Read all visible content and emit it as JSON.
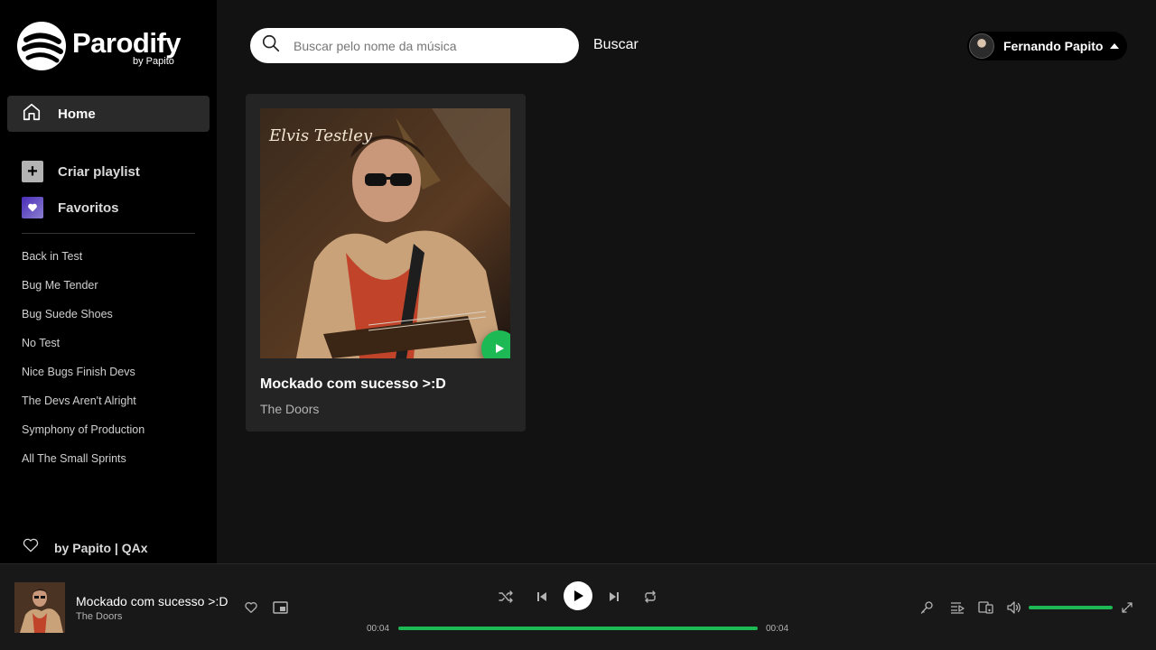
{
  "app": {
    "name": "Parodify",
    "byline": "by Papito"
  },
  "search": {
    "placeholder": "Buscar pelo nome da música",
    "button_label": "Buscar"
  },
  "user": {
    "name": "Fernando Papito"
  },
  "sidebar": {
    "home_label": "Home",
    "create_playlist_label": "Criar playlist",
    "favorites_label": "Favoritos",
    "playlists": [
      "Back in Test",
      "Bug Me Tender",
      "Bug Suede Shoes",
      "No Test",
      "Nice Bugs Finish Devs",
      "The Devs Aren't Alright",
      "Symphony of Production",
      "All The Small Sprints"
    ],
    "credit": "by Papito | QAx"
  },
  "card": {
    "title": "Mockado com sucesso >:D",
    "artist": "The Doors",
    "cover_text": "Elvis Testley"
  },
  "player": {
    "title": "Mockado com sucesso >:D",
    "artist": "The Doors",
    "time_elapsed": "00:04",
    "time_total": "00:04",
    "progress_percent": 100,
    "volume_percent": 100
  },
  "colors": {
    "accent": "#1db954",
    "sidebar_bg": "#000000",
    "main_bg": "#121212",
    "card_bg": "#242424",
    "player_bg": "#181818"
  }
}
